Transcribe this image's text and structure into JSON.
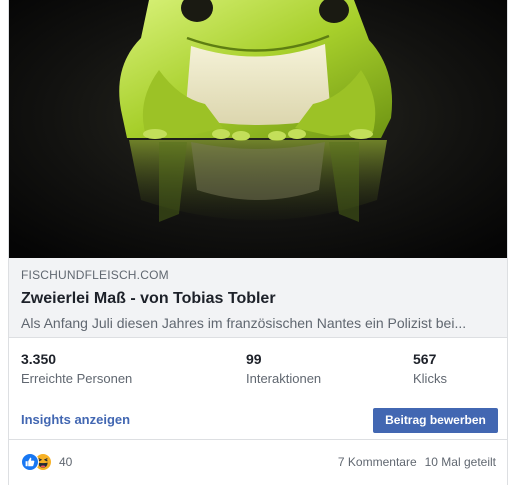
{
  "image": {
    "alt": "",
    "icon": "frog-photo"
  },
  "link_preview": {
    "domain": "FISCHUNDFLEISCH.COM",
    "title": "Zweierlei Maß - von Tobias Tobler",
    "description": "Als Anfang Juli diesen Jahres im französischen Nantes ein Polizist bei..."
  },
  "stats": {
    "reach": {
      "value": "3.350",
      "label": "Erreichte Personen"
    },
    "engagements": {
      "value": "99",
      "label": "Interaktionen"
    },
    "clicks": {
      "value": "567",
      "label": "Klicks"
    }
  },
  "actions": {
    "insights_label": "Insights anzeigen",
    "boost_label": "Beitrag bewerben"
  },
  "footer": {
    "reaction_icons": [
      "like-icon",
      "haha-icon"
    ],
    "reaction_count": "40",
    "comments": "7 Kommentare",
    "shares": "10 Mal geteilt"
  },
  "colors": {
    "accent": "#4267b2",
    "preview_bg": "#f2f3f5",
    "secondary_text": "#606770"
  }
}
